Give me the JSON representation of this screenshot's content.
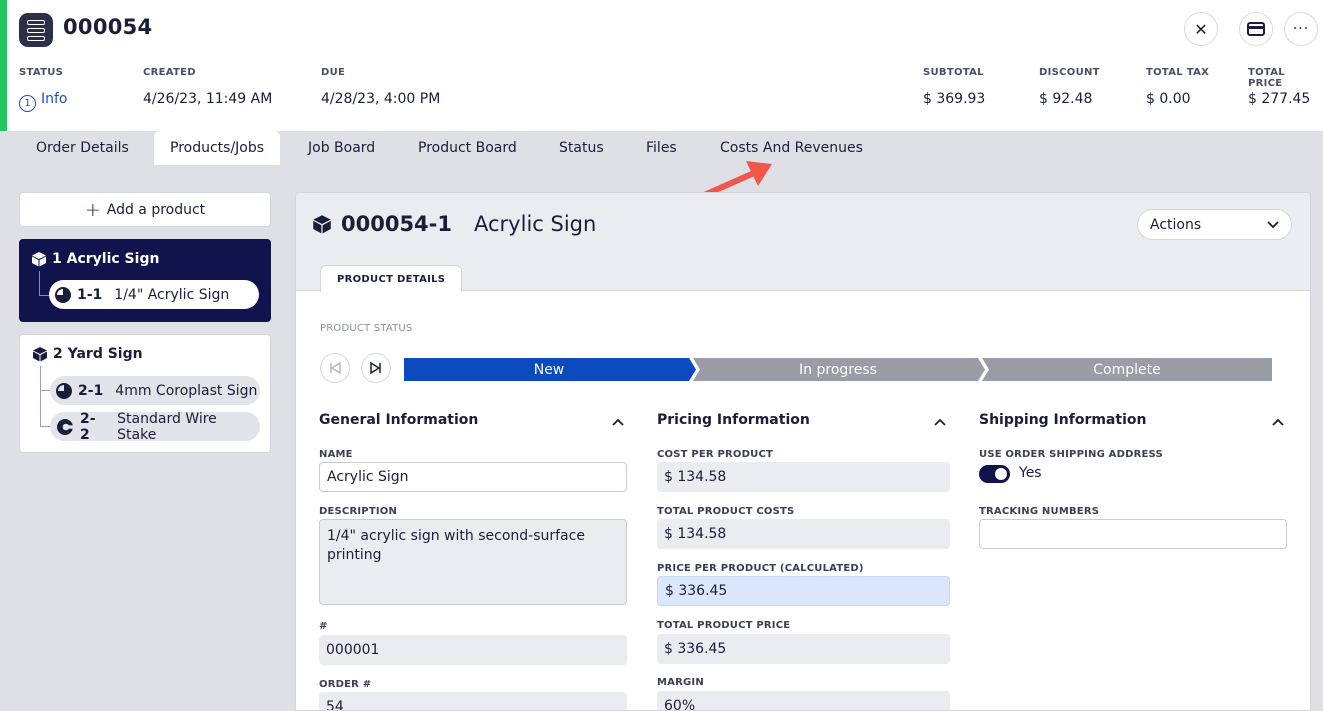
{
  "header": {
    "order_number": "000054",
    "close_icon": "close-icon",
    "payment_icon": "credit-card-icon",
    "more_icon": "more-horizontal-icon",
    "status": {
      "label": "STATUS",
      "step": "1",
      "value": "Info"
    },
    "created": {
      "label": "CREATED",
      "value": "4/26/23, 11:49 AM"
    },
    "due": {
      "label": "DUE",
      "value": "4/28/23, 4:00 PM"
    },
    "subtotal": {
      "label": "SUBTOTAL",
      "value": "$ 369.93"
    },
    "discount": {
      "label": "DISCOUNT",
      "value": "$ 92.48"
    },
    "total_tax": {
      "label": "TOTAL TAX",
      "value": "$ 0.00"
    },
    "total_price": {
      "label": "TOTAL PRICE",
      "value": "$ 277.45"
    }
  },
  "tabs": [
    {
      "label": "Order Details"
    },
    {
      "label": "Products/Jobs"
    },
    {
      "label": "Job Board"
    },
    {
      "label": "Product Board"
    },
    {
      "label": "Status"
    },
    {
      "label": "Files"
    },
    {
      "label": "Costs And Revenues"
    }
  ],
  "active_tab": "Products/Jobs",
  "sidebar": {
    "add_label": "Add a product",
    "products": [
      {
        "number": "1",
        "name": "Acrylic Sign",
        "jobs": [
          {
            "number": "1-1",
            "name": "1/4\" Acrylic Sign"
          }
        ]
      },
      {
        "number": "2",
        "name": "Yard Sign",
        "jobs": [
          {
            "number": "2-1",
            "name": "4mm Coroplast Sign"
          },
          {
            "number": "2-2",
            "name": "Standard Wire Stake"
          }
        ]
      }
    ]
  },
  "product": {
    "number": "000054-1",
    "name": "Acrylic Sign",
    "actions_label": "Actions",
    "subtab": "PRODUCT DETAILS",
    "status_label": "PRODUCT STATUS",
    "steps": [
      "New",
      "In progress",
      "Complete"
    ],
    "current_step": "New",
    "general": {
      "title": "General Information",
      "name_label": "NAME",
      "name_value": "Acrylic Sign",
      "description_label": "DESCRIPTION",
      "description_value": "1/4\" acrylic sign with second-surface printing",
      "number_label": "#",
      "number_value": "000001",
      "order_label": "ORDER #",
      "order_value": "54"
    },
    "pricing": {
      "title": "Pricing Information",
      "cost_per_product_label": "COST PER PRODUCT",
      "cost_per_product": "$ 134.58",
      "total_costs_label": "TOTAL PRODUCT COSTS",
      "total_costs": "$ 134.58",
      "price_per_product_label": "PRICE PER PRODUCT (CALCULATED)",
      "price_per_product": "$ 336.45",
      "total_price_label": "TOTAL PRODUCT PRICE",
      "total_price": "$ 336.45",
      "margin_label": "MARGIN",
      "margin": "60%"
    },
    "shipping": {
      "title": "Shipping Information",
      "use_order_label": "USE ORDER SHIPPING ADDRESS",
      "use_order_value": "Yes",
      "tracking_label": "TRACKING NUMBERS",
      "tracking_value": ""
    }
  },
  "colors": {
    "accent_green": "#22c55e",
    "navy": "#11134d",
    "step_active": "#0b4bbd",
    "step_inactive": "#9a9ca6",
    "annotation_arrow": "#f0574a"
  }
}
